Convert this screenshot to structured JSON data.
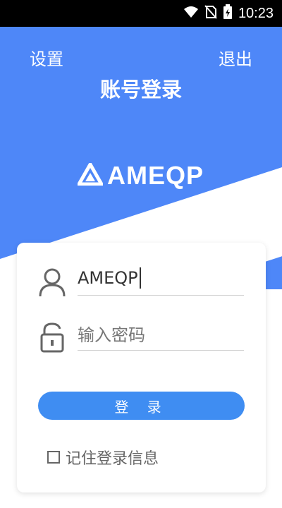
{
  "status_bar": {
    "time": "10:23",
    "icons": [
      "wifi-icon",
      "no-sim-icon",
      "battery-charging-icon"
    ]
  },
  "header": {
    "settings_label": "设置",
    "exit_label": "退出",
    "title": "账号登录",
    "logo_text": "AMEQP"
  },
  "form": {
    "username_value": "AMEQP",
    "password_placeholder": "输入密码",
    "login_label": "登 录",
    "remember_label": "记住登录信息",
    "remember_checked": false
  },
  "colors": {
    "header_bg": "#4e87f8",
    "button_bg": "#3f8df2",
    "text": "#333333",
    "muted_text": "#666666"
  }
}
